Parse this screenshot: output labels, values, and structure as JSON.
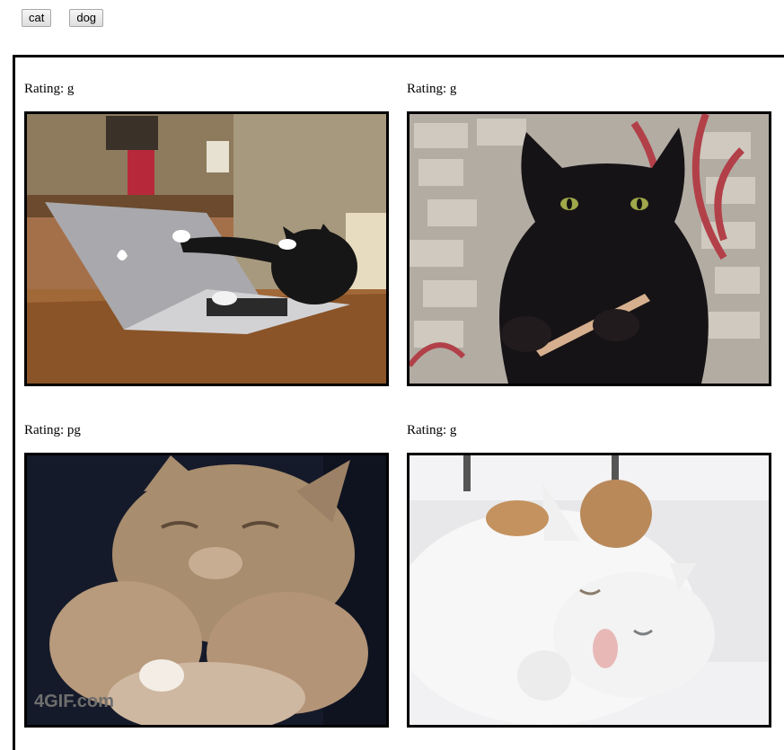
{
  "toolbar": {
    "cat_label": "cat",
    "dog_label": "dog"
  },
  "gifs": [
    {
      "rating_prefix": "Rating:",
      "rating": "g",
      "subject": "cat typing on laptop"
    },
    {
      "rating_prefix": "Rating:",
      "rating": "g",
      "subject": "black cat filing nails"
    },
    {
      "rating_prefix": "Rating:",
      "rating": "pg",
      "subject": "sleepy kitten",
      "watermark": "4GIF.com"
    },
    {
      "rating_prefix": "Rating:",
      "rating": "g",
      "subject": "white cat with bread roll on head"
    }
  ]
}
